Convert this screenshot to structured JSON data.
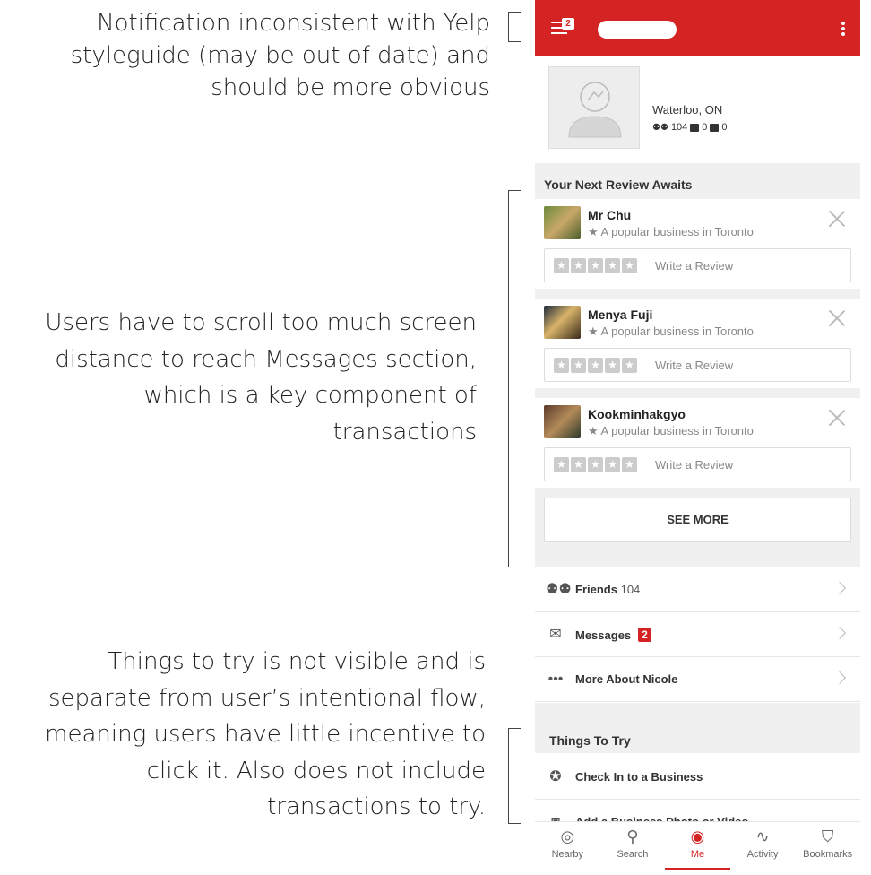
{
  "annotations": {
    "note_1": [
      "Notification inconsistent with Yelp",
      "styleguide (may be out of date) and",
      "should be more obvious"
    ],
    "note_2": [
      "Users have to scroll too much screen",
      "distance to reach Messages section,",
      "which is a key component of",
      "transactions"
    ],
    "note_3": [
      "Things to try is not visible and is",
      "separate from user’s intentional flow,",
      "meaning users have little incentive to",
      "click it. Also does not include",
      "transactions to try."
    ]
  },
  "app": {
    "brand_color": "#d32323",
    "notification_count": "2",
    "profile": {
      "location": "Waterloo, ON",
      "friends_count": "104",
      "reviews_count": "0",
      "photos_count": "0"
    },
    "review_section": {
      "title": "Your Next Review Awaits",
      "items": [
        {
          "name": "Mr Chu",
          "subtitle": "★ A popular business in Toronto",
          "action": "Write a Review"
        },
        {
          "name": "Menya Fuji",
          "subtitle": "★ A popular business in Toronto",
          "action": "Write a Review"
        },
        {
          "name": "Kookminhakgyo",
          "subtitle": "★ A popular business in Toronto",
          "action": "Write a Review"
        }
      ],
      "see_more": "SEE MORE"
    },
    "menu": {
      "friends_label": "Friends",
      "friends_count": "104",
      "messages_label": "Messages",
      "messages_badge": "2",
      "more_label": "More About Nicole"
    },
    "things_to_try": {
      "title": "Things To Try",
      "items": [
        "Check In to a Business",
        "Add a Business Photo or Video"
      ]
    },
    "tabs": [
      {
        "label": "Nearby",
        "icon": "compass-icon"
      },
      {
        "label": "Search",
        "icon": "search-icon"
      },
      {
        "label": "Me",
        "icon": "user-icon"
      },
      {
        "label": "Activity",
        "icon": "activity-icon"
      },
      {
        "label": "Bookmarks",
        "icon": "bookmark-icon"
      }
    ]
  }
}
